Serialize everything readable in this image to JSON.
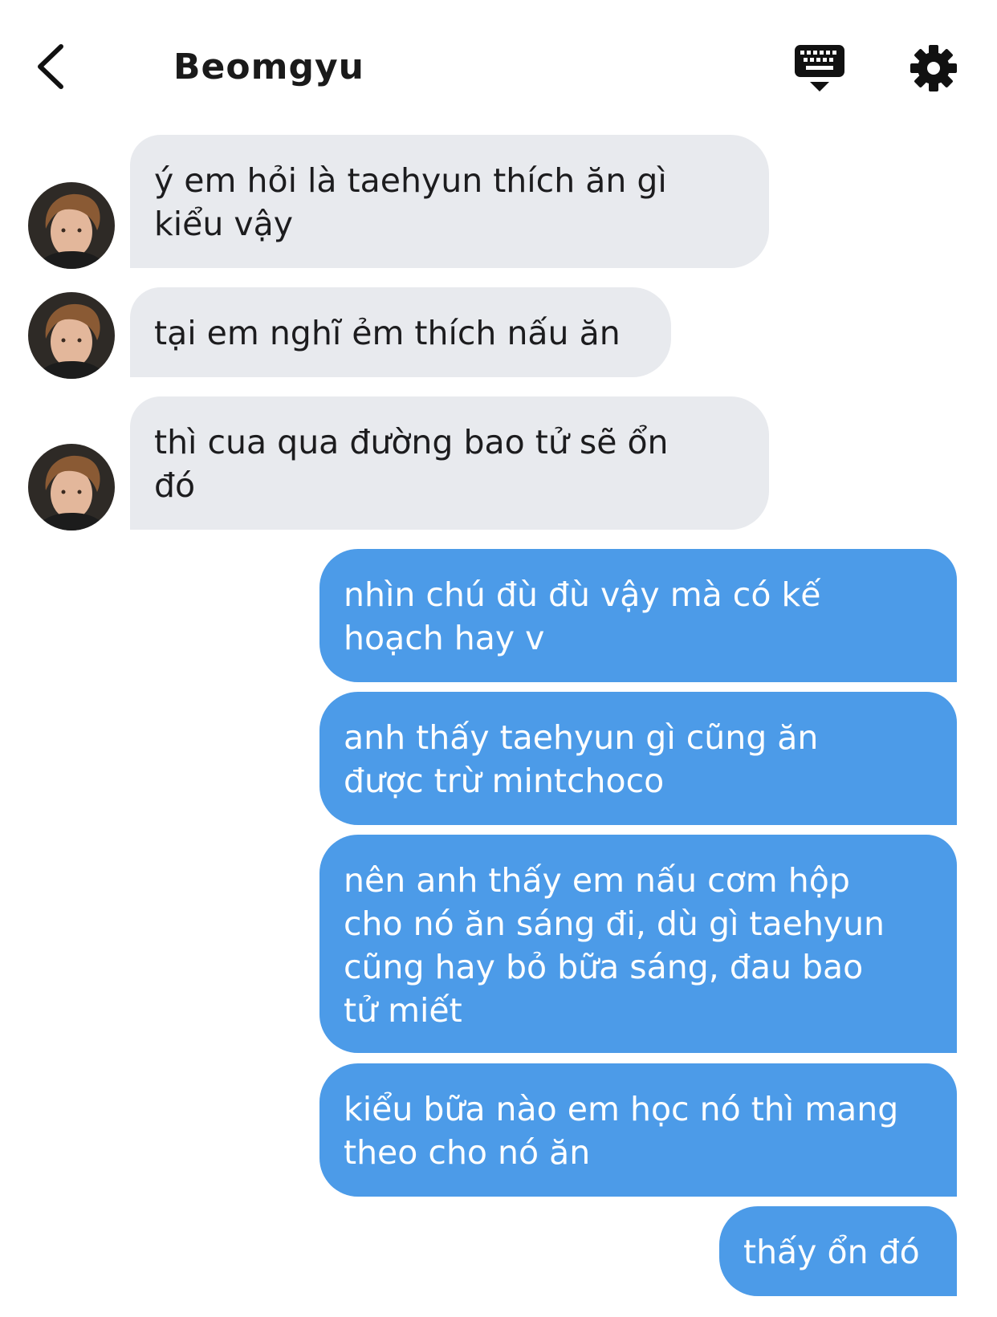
{
  "header": {
    "title": "Beomgyu",
    "back_icon": "chevron-left-icon",
    "keyboard_icon": "keyboard-icon",
    "settings_icon": "gear-icon"
  },
  "colors": {
    "incoming_bubble": "#e8eaee",
    "outgoing_bubble": "#4c9be8",
    "incoming_text": "#1c1c1e",
    "outgoing_text": "#ffffff"
  },
  "messages": [
    {
      "direction": "incoming",
      "text": "ý em hỏi là taehyun thích ăn gì\nkiểu vậy"
    },
    {
      "direction": "incoming",
      "text": "tại em nghĩ ẻm thích nấu ăn"
    },
    {
      "direction": "incoming",
      "text": "thì cua qua đường bao tử sẽ ổn\nđó"
    },
    {
      "direction": "outgoing",
      "text": "nhìn chú đù đù vậy mà có kế\nhoạch hay v"
    },
    {
      "direction": "outgoing",
      "text": "anh thấy taehyun gì cũng ăn\nđược trừ mintchoco"
    },
    {
      "direction": "outgoing",
      "text": "nên anh thấy em nấu cơm hộp\ncho nó ăn sáng đi, dù gì taehyun\ncũng hay bỏ bữa sáng, đau bao\ntử miết"
    },
    {
      "direction": "outgoing",
      "text": "kiểu bữa nào em học nó thì mang\ntheo cho nó ăn"
    },
    {
      "direction": "outgoing",
      "text": "thấy ổn đó"
    }
  ]
}
